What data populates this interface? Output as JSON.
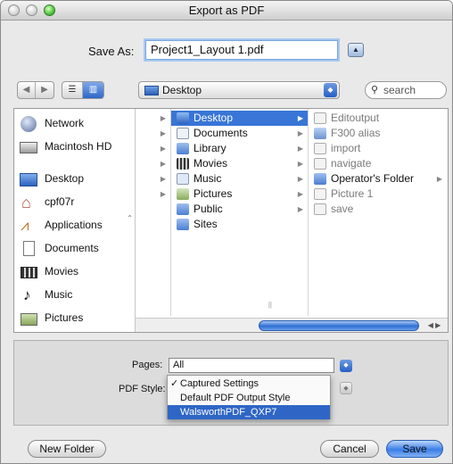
{
  "window": {
    "title": "Export as PDF"
  },
  "saveas": {
    "label": "Save As:",
    "filename": "Project1_Layout 1.pdf"
  },
  "toolbar": {
    "location": "Desktop",
    "search_placeholder": "search"
  },
  "sidebar": {
    "items": [
      {
        "label": "Network",
        "icon": "network-globe-icon"
      },
      {
        "label": "Macintosh HD",
        "icon": "hard-disk-icon"
      },
      {
        "label": "Desktop",
        "icon": "desktop-icon"
      },
      {
        "label": "cpf07r",
        "icon": "home-icon"
      },
      {
        "label": "Applications",
        "icon": "applications-icon"
      },
      {
        "label": "Documents",
        "icon": "document-icon"
      },
      {
        "label": "Movies",
        "icon": "movies-icon"
      },
      {
        "label": "Music",
        "icon": "music-icon"
      },
      {
        "label": "Pictures",
        "icon": "pictures-icon"
      }
    ]
  },
  "columns": {
    "home": [
      "Desktop",
      "Documents",
      "Library",
      "Movies",
      "Music",
      "Pictures",
      "Public",
      "Sites"
    ],
    "desktop": [
      "Editoutput",
      "F300 alias",
      "import",
      "navigate",
      "Operator's Folder",
      "Picture 1",
      "save"
    ]
  },
  "options": {
    "pages_label": "Pages:",
    "pages_value": "All",
    "style_label": "PDF Style:",
    "style_menu": [
      "Captured Settings",
      "Default PDF Output Style",
      "WalsworthPDF_QXP7"
    ]
  },
  "buttons": {
    "new_folder": "New Folder",
    "cancel": "Cancel",
    "save": "Save"
  }
}
